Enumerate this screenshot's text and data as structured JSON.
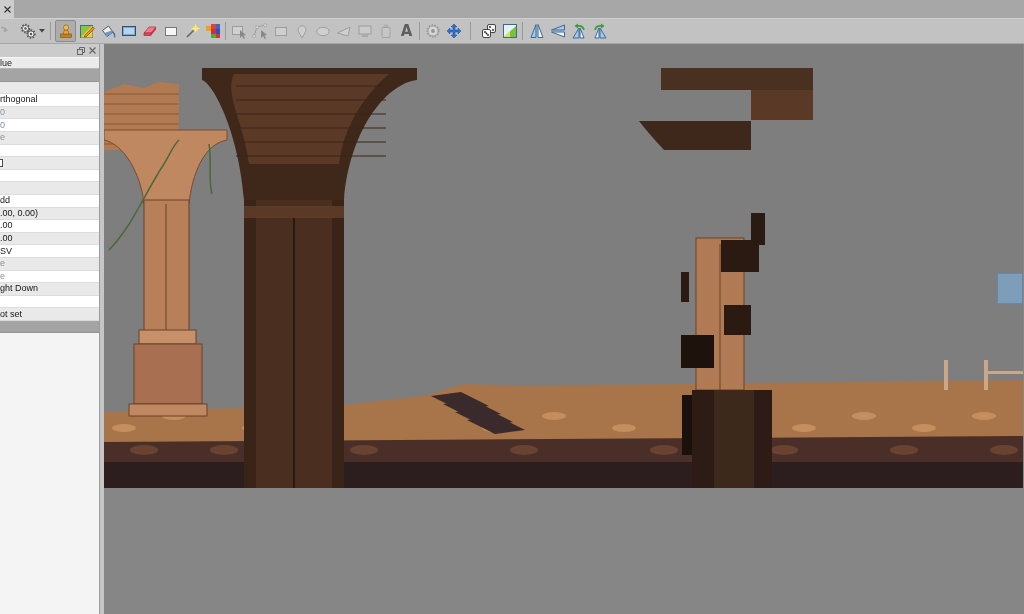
{
  "tab_bar": {
    "tabs": [
      {
        "selected": true
      }
    ]
  },
  "toolbar": {
    "groups": [
      [
        {
          "kind": "redo",
          "selected": false,
          "disabled": true
        },
        {
          "kind": "commands",
          "selected": false,
          "disabled": false
        }
      ],
      [
        {
          "kind": "stamp",
          "selected": true,
          "disabled": false
        },
        {
          "kind": "terrain",
          "selected": false,
          "disabled": false
        },
        {
          "kind": "bucket",
          "selected": false,
          "disabled": false
        },
        {
          "kind": "shape_fill",
          "selected": false,
          "disabled": false
        },
        {
          "kind": "eraser",
          "selected": false,
          "disabled": false
        },
        {
          "kind": "rect_select",
          "selected": false,
          "disabled": false
        },
        {
          "kind": "magic_wand",
          "selected": false,
          "disabled": false
        },
        {
          "kind": "select_same",
          "selected": false,
          "disabled": false
        }
      ],
      [
        {
          "kind": "select_objects",
          "selected": false,
          "disabled": true
        },
        {
          "kind": "edit_polygons",
          "selected": false,
          "disabled": true
        },
        {
          "kind": "rectangle",
          "selected": false,
          "disabled": true
        },
        {
          "kind": "point",
          "selected": false,
          "disabled": true
        },
        {
          "kind": "ellipse",
          "selected": false,
          "disabled": true
        },
        {
          "kind": "polygon",
          "selected": false,
          "disabled": true
        },
        {
          "kind": "tile",
          "selected": false,
          "disabled": true
        },
        {
          "kind": "template",
          "selected": false,
          "disabled": true
        },
        {
          "kind": "text",
          "glyph": "A",
          "selected": false,
          "disabled": true
        }
      ],
      [
        {
          "kind": "world",
          "selected": false,
          "disabled": true
        },
        {
          "kind": "move",
          "selected": false,
          "disabled": false
        }
      ],
      [
        {
          "kind": "random",
          "selected": false,
          "disabled": false
        },
        {
          "kind": "wang",
          "selected": false,
          "disabled": false
        }
      ],
      [
        {
          "kind": "flip_h",
          "selected": false,
          "disabled": false
        },
        {
          "kind": "flip_v",
          "selected": false,
          "disabled": false
        },
        {
          "kind": "rotate_left",
          "selected": false,
          "disabled": false
        },
        {
          "kind": "rotate_right",
          "selected": false,
          "disabled": false
        }
      ]
    ]
  },
  "properties": {
    "header": "lue",
    "rows": [
      {
        "kind": "group"
      },
      {
        "kind": "blank"
      },
      {
        "kind": "value",
        "text": "rthogonal",
        "disabled": false
      },
      {
        "kind": "value",
        "text": "0",
        "disabled": true
      },
      {
        "kind": "value",
        "text": "0",
        "disabled": true
      },
      {
        "kind": "value",
        "text": "e",
        "disabled": true
      },
      {
        "kind": "blank"
      },
      {
        "kind": "checkbox",
        "checked": false
      },
      {
        "kind": "blank"
      },
      {
        "kind": "blank"
      },
      {
        "kind": "value",
        "text": "dd",
        "disabled": false
      },
      {
        "kind": "value",
        "text": ".00, 0.00)",
        "disabled": false
      },
      {
        "kind": "value",
        "text": ".00",
        "disabled": false
      },
      {
        "kind": "value",
        "text": ".00",
        "disabled": false
      },
      {
        "kind": "value",
        "text": "SV",
        "disabled": false
      },
      {
        "kind": "value",
        "text": "e",
        "disabled": true
      },
      {
        "kind": "value",
        "text": "e",
        "disabled": true
      },
      {
        "kind": "value",
        "text": "ght Down",
        "disabled": false
      },
      {
        "kind": "blank"
      },
      {
        "kind": "value",
        "text": "ot set",
        "disabled": false
      },
      {
        "kind": "group"
      }
    ]
  }
}
